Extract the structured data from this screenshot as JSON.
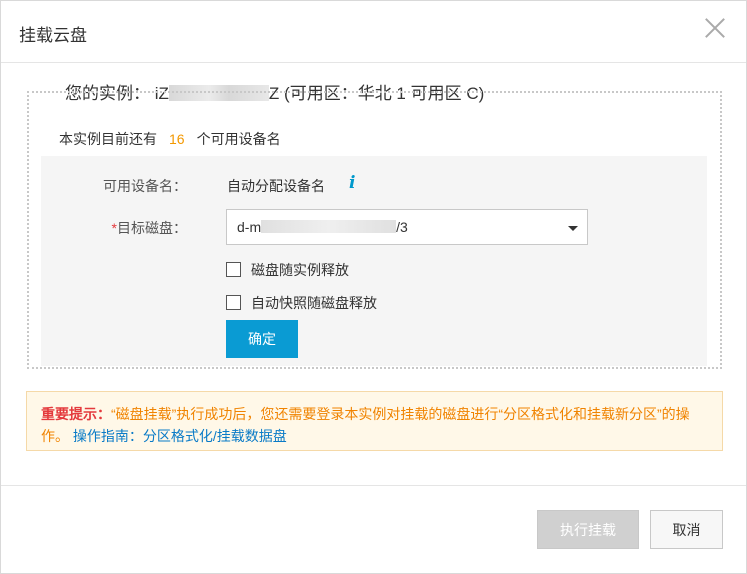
{
  "dialog": {
    "title": "挂载云盘"
  },
  "instance": {
    "prefix": "您的实例：",
    "id_start": "iZ",
    "id_end": "Z",
    "zone": "(可用区：华北 1 可用区 C)"
  },
  "device_count": {
    "prefix": "本实例目前还有",
    "count": "16",
    "suffix": "个可用设备名"
  },
  "form": {
    "device_label": "可用设备名：",
    "device_value": "自动分配设备名",
    "info_icon": "i",
    "disk_required": "*",
    "disk_label": "目标磁盘：",
    "disk_value_start": "d-m",
    "disk_value_end": "/3",
    "release_with_instance": "磁盘随实例释放",
    "auto_snapshot_release": "自动快照随磁盘释放",
    "confirm": "确定"
  },
  "notice": {
    "label": "重要提示：",
    "text": "“磁盘挂载”执行成功后，您还需要登录本实例对挂载的磁盘进行“分区格式化和挂载新分区”的操作。",
    "guide": "操作指南：分区格式化/挂载数据盘"
  },
  "footer": {
    "execute": "执行挂载",
    "cancel": "取消"
  },
  "icons": {
    "close": "close-icon",
    "info": "info-icon",
    "dropdown": "chevron-down-icon"
  },
  "colors": {
    "primary": "#0a9bd3",
    "count": "#f39800",
    "warning": "#f08300",
    "required": "#e4393c",
    "link": "#0a7bc7"
  }
}
